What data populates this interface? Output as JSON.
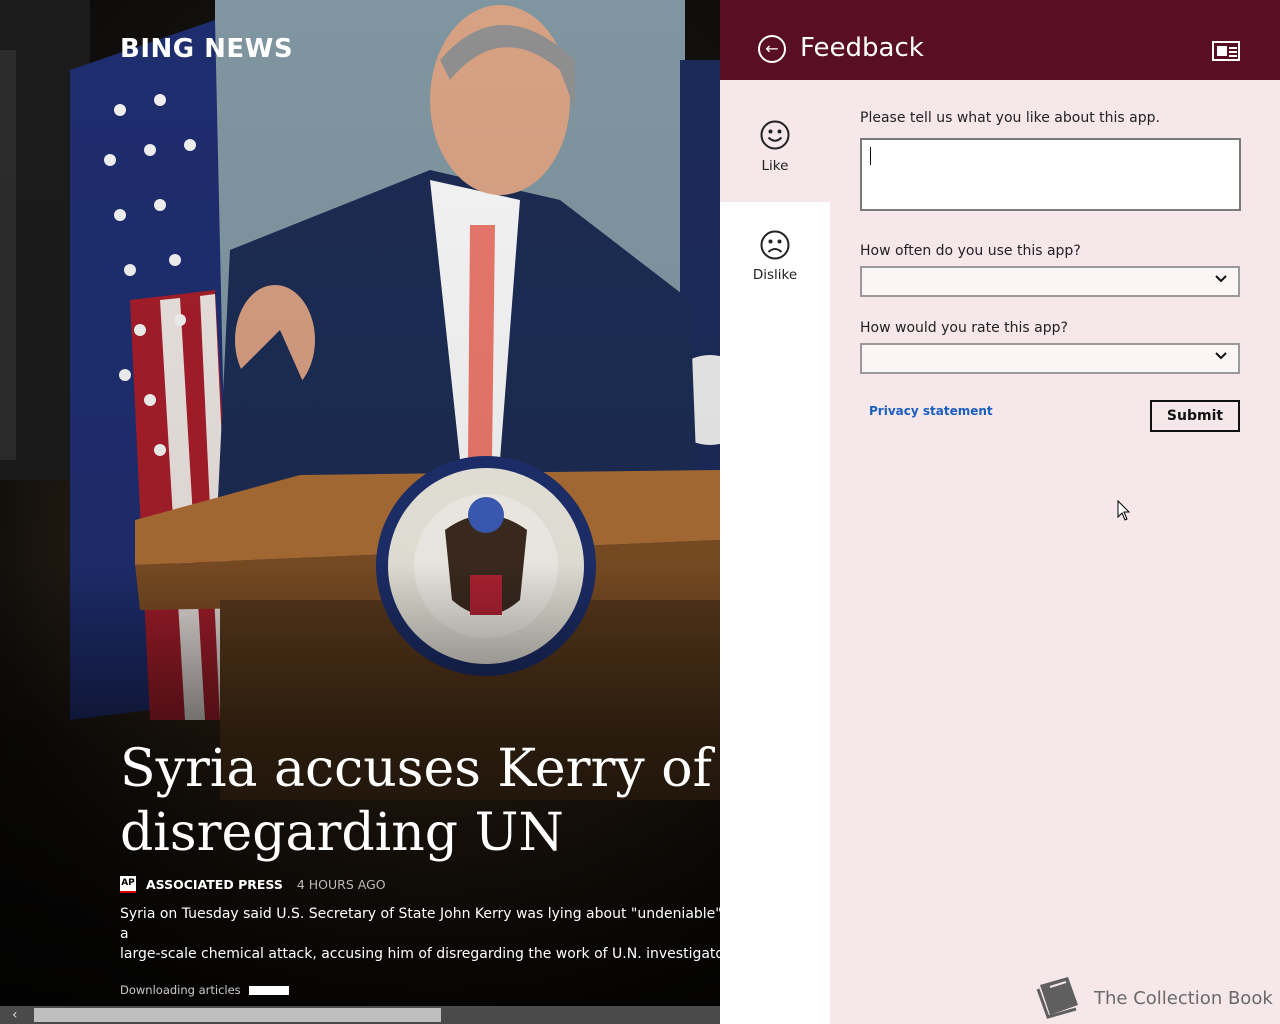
{
  "news": {
    "brand": "BING NEWS",
    "headline": "Syria accuses Kerry of lying,\ndisregarding UN",
    "source_logo": "AP",
    "source": "ASSOCIATED PRESS",
    "age": "4 HOURS AGO",
    "summary": "Syria on Tuesday said U.S. Secretary of State John Kerry was lying about \"undeniable\" evidence of a\nlarge-scale chemical attack, accusing him of disregarding the work of U.N. investigators.",
    "download_status": "Downloading articles"
  },
  "feedback": {
    "title": "Feedback",
    "back_icon": "back-arrow-icon",
    "header_icon": "news-view-icon",
    "tabs": [
      {
        "label": "Like",
        "icon": "smiley-icon",
        "selected": true
      },
      {
        "label": "Dislike",
        "icon": "frown-icon",
        "selected": false
      }
    ],
    "like_prompt": "Please tell us what you like about this app.",
    "like_value": "",
    "frequency_label": "How often do you use this app?",
    "frequency_value": "",
    "rating_label": "How would you rate this app?",
    "rating_value": "",
    "privacy_link": "Privacy statement",
    "submit_label": "Submit"
  },
  "watermark": "The Collection Book",
  "colors": {
    "header_bg": "#580e23",
    "pane_bg": "#f5e7ea",
    "link": "#1a5fbf"
  }
}
